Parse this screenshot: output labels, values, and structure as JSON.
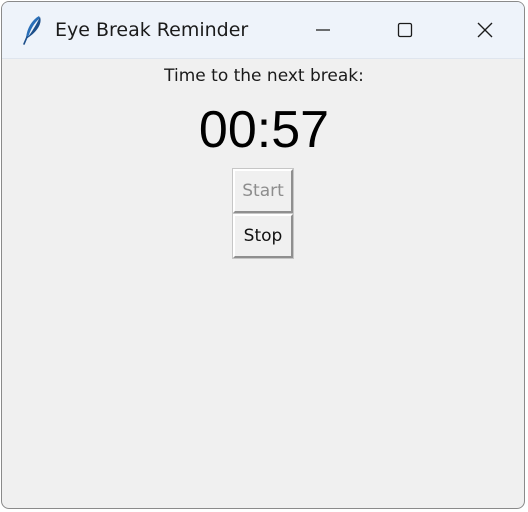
{
  "window": {
    "title": "Eye Break Reminder",
    "app_icon": "feather-icon",
    "controls": {
      "minimize_icon": "minimize-icon",
      "maximize_icon": "maximize-icon",
      "close_icon": "close-icon"
    }
  },
  "main": {
    "next_break_label": "Time to the next break:",
    "countdown": "00:57",
    "start_label": "Start",
    "start_enabled": false,
    "stop_label": "Stop",
    "stop_enabled": true
  },
  "colors": {
    "titlebar": "#eef3fa",
    "body": "#f0f0f0",
    "disabled_text": "#8d8d8d"
  }
}
